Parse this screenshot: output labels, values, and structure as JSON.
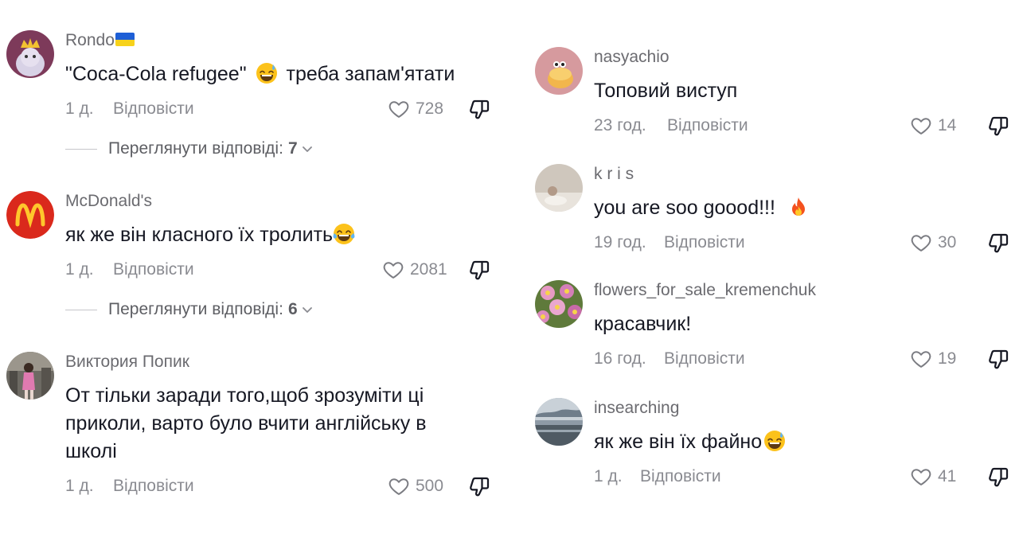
{
  "left_column": {
    "comments": [
      {
        "username": "Rondo",
        "flag": "ukraine-flag",
        "text_before": "\"Coca-Cola refugee\"",
        "emoji": "sweat-smile-emoji",
        "text_after": "треба запам'ятати",
        "time": "1 д.",
        "reply_label": "Відповісти",
        "likes": "728",
        "view_replies_label": "Переглянути відповіді:",
        "view_replies_count": "7"
      },
      {
        "username": "McDonald's",
        "text_before": "як же він класного їх тролить",
        "emoji": "tears-of-joy-emoji",
        "time": "1 д.",
        "reply_label": "Відповісти",
        "likes": "2081",
        "view_replies_label": "Переглянути відповіді:",
        "view_replies_count": "6"
      },
      {
        "username": "Виктория Попик",
        "text_line1": "От тільки заради того,щоб зрозуміти ці",
        "text_line2": "приколи, варто було вчити англійську в",
        "text_line3": "школі",
        "time": "1 д.",
        "reply_label": "Відповісти",
        "likes": "500"
      }
    ]
  },
  "right_column": {
    "comments": [
      {
        "username": "nasyachio",
        "text": "Топовий виступ",
        "time": "23 год.",
        "reply_label": "Відповісти",
        "likes": "14"
      },
      {
        "username": "k r i s",
        "text": "you are soo goood!!!",
        "emoji": "fire-emoji",
        "time": "19 год.",
        "reply_label": "Відповісти",
        "likes": "30"
      },
      {
        "username": "flowers_for_sale_kremenchuk",
        "text": "красавчик!",
        "time": "16 год.",
        "reply_label": "Відповісти",
        "likes": "19"
      },
      {
        "username": "insearching",
        "text": "як же він їх файно",
        "emoji": "sweat-smile-emoji",
        "time": "1 д.",
        "reply_label": "Відповісти",
        "likes": "41"
      }
    ]
  },
  "colors": {
    "text": "#161823",
    "secondary": "#8a8b91",
    "username": "#6b6b70",
    "mcdonalds_red": "#da291c",
    "mcdonalds_yellow": "#ffc72c"
  }
}
